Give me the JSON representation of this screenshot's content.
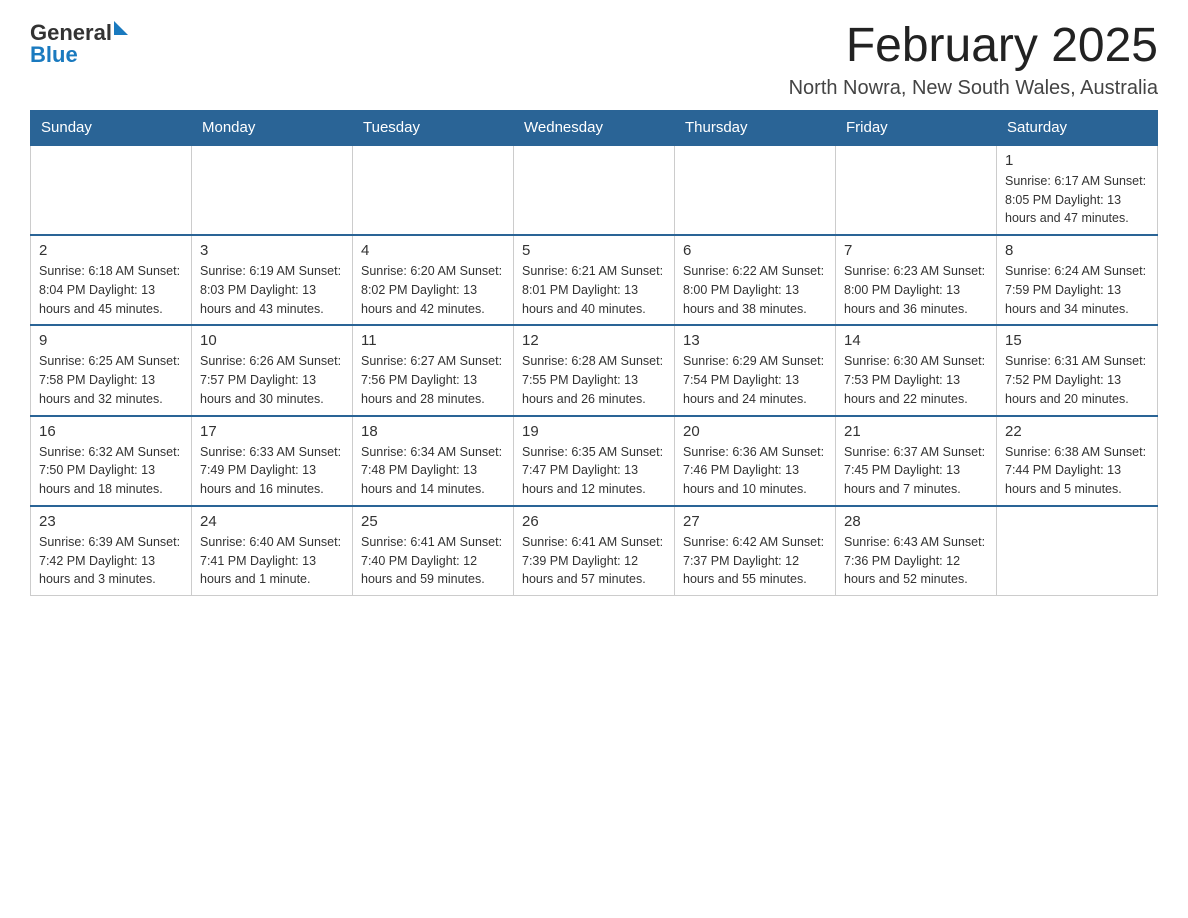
{
  "header": {
    "logo_general": "General",
    "logo_blue": "Blue",
    "main_title": "February 2025",
    "subtitle": "North Nowra, New South Wales, Australia"
  },
  "days_of_week": [
    "Sunday",
    "Monday",
    "Tuesday",
    "Wednesday",
    "Thursday",
    "Friday",
    "Saturday"
  ],
  "weeks": [
    [
      {
        "day": "",
        "info": ""
      },
      {
        "day": "",
        "info": ""
      },
      {
        "day": "",
        "info": ""
      },
      {
        "day": "",
        "info": ""
      },
      {
        "day": "",
        "info": ""
      },
      {
        "day": "",
        "info": ""
      },
      {
        "day": "1",
        "info": "Sunrise: 6:17 AM\nSunset: 8:05 PM\nDaylight: 13 hours and 47 minutes."
      }
    ],
    [
      {
        "day": "2",
        "info": "Sunrise: 6:18 AM\nSunset: 8:04 PM\nDaylight: 13 hours and 45 minutes."
      },
      {
        "day": "3",
        "info": "Sunrise: 6:19 AM\nSunset: 8:03 PM\nDaylight: 13 hours and 43 minutes."
      },
      {
        "day": "4",
        "info": "Sunrise: 6:20 AM\nSunset: 8:02 PM\nDaylight: 13 hours and 42 minutes."
      },
      {
        "day": "5",
        "info": "Sunrise: 6:21 AM\nSunset: 8:01 PM\nDaylight: 13 hours and 40 minutes."
      },
      {
        "day": "6",
        "info": "Sunrise: 6:22 AM\nSunset: 8:00 PM\nDaylight: 13 hours and 38 minutes."
      },
      {
        "day": "7",
        "info": "Sunrise: 6:23 AM\nSunset: 8:00 PM\nDaylight: 13 hours and 36 minutes."
      },
      {
        "day": "8",
        "info": "Sunrise: 6:24 AM\nSunset: 7:59 PM\nDaylight: 13 hours and 34 minutes."
      }
    ],
    [
      {
        "day": "9",
        "info": "Sunrise: 6:25 AM\nSunset: 7:58 PM\nDaylight: 13 hours and 32 minutes."
      },
      {
        "day": "10",
        "info": "Sunrise: 6:26 AM\nSunset: 7:57 PM\nDaylight: 13 hours and 30 minutes."
      },
      {
        "day": "11",
        "info": "Sunrise: 6:27 AM\nSunset: 7:56 PM\nDaylight: 13 hours and 28 minutes."
      },
      {
        "day": "12",
        "info": "Sunrise: 6:28 AM\nSunset: 7:55 PM\nDaylight: 13 hours and 26 minutes."
      },
      {
        "day": "13",
        "info": "Sunrise: 6:29 AM\nSunset: 7:54 PM\nDaylight: 13 hours and 24 minutes."
      },
      {
        "day": "14",
        "info": "Sunrise: 6:30 AM\nSunset: 7:53 PM\nDaylight: 13 hours and 22 minutes."
      },
      {
        "day": "15",
        "info": "Sunrise: 6:31 AM\nSunset: 7:52 PM\nDaylight: 13 hours and 20 minutes."
      }
    ],
    [
      {
        "day": "16",
        "info": "Sunrise: 6:32 AM\nSunset: 7:50 PM\nDaylight: 13 hours and 18 minutes."
      },
      {
        "day": "17",
        "info": "Sunrise: 6:33 AM\nSunset: 7:49 PM\nDaylight: 13 hours and 16 minutes."
      },
      {
        "day": "18",
        "info": "Sunrise: 6:34 AM\nSunset: 7:48 PM\nDaylight: 13 hours and 14 minutes."
      },
      {
        "day": "19",
        "info": "Sunrise: 6:35 AM\nSunset: 7:47 PM\nDaylight: 13 hours and 12 minutes."
      },
      {
        "day": "20",
        "info": "Sunrise: 6:36 AM\nSunset: 7:46 PM\nDaylight: 13 hours and 10 minutes."
      },
      {
        "day": "21",
        "info": "Sunrise: 6:37 AM\nSunset: 7:45 PM\nDaylight: 13 hours and 7 minutes."
      },
      {
        "day": "22",
        "info": "Sunrise: 6:38 AM\nSunset: 7:44 PM\nDaylight: 13 hours and 5 minutes."
      }
    ],
    [
      {
        "day": "23",
        "info": "Sunrise: 6:39 AM\nSunset: 7:42 PM\nDaylight: 13 hours and 3 minutes."
      },
      {
        "day": "24",
        "info": "Sunrise: 6:40 AM\nSunset: 7:41 PM\nDaylight: 13 hours and 1 minute."
      },
      {
        "day": "25",
        "info": "Sunrise: 6:41 AM\nSunset: 7:40 PM\nDaylight: 12 hours and 59 minutes."
      },
      {
        "day": "26",
        "info": "Sunrise: 6:41 AM\nSunset: 7:39 PM\nDaylight: 12 hours and 57 minutes."
      },
      {
        "day": "27",
        "info": "Sunrise: 6:42 AM\nSunset: 7:37 PM\nDaylight: 12 hours and 55 minutes."
      },
      {
        "day": "28",
        "info": "Sunrise: 6:43 AM\nSunset: 7:36 PM\nDaylight: 12 hours and 52 minutes."
      },
      {
        "day": "",
        "info": ""
      }
    ]
  ]
}
